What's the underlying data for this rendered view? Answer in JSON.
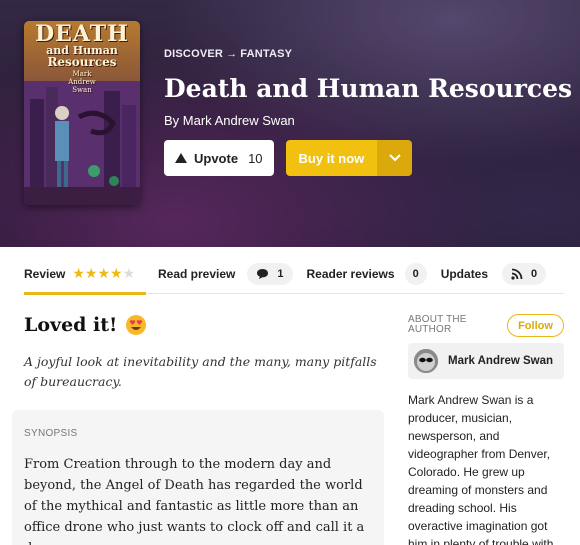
{
  "breadcrumb": {
    "parent": "DISCOVER",
    "separator": "→",
    "current": "FANTASY"
  },
  "book": {
    "title": "Death and Human Resources",
    "byline": "By Mark Andrew Swan",
    "cover": {
      "line1": "DEATH",
      "line2": "and Human",
      "line3": "Resources",
      "author_line1": "Mark",
      "author_line2": "Andrew",
      "author_line3": "Swan"
    }
  },
  "actions": {
    "upvote_label": "Upvote",
    "upvote_count": "10",
    "buy_label": "Buy it now"
  },
  "tabs": {
    "review": "Review",
    "rating": 4,
    "rating_max": 5,
    "read_preview": "Read preview",
    "comments_count": "1",
    "reader_reviews": "Reader reviews",
    "reader_reviews_count": "0",
    "updates": "Updates",
    "rss_count": "0"
  },
  "review": {
    "title": "Loved it!",
    "emoji": "😍",
    "tagline": "A joyful look at inevitability and the many, many pitfalls of bureaucracy."
  },
  "synopsis": {
    "label": "SYNOPSIS",
    "text": "From Creation through to the modern day and beyond, the Angel of Death has regarded the world of the mythical and fantastic as little more than an office drone who just wants to clock off and call it a day."
  },
  "author": {
    "about_label": "ABOUT THE AUTHOR",
    "follow_label": "Follow",
    "name": "Mark Andrew Swan",
    "bio": "Mark Andrew Swan is a producer, musician, newsperson, and videographer from Denver, Colorado. He grew up dreaming of monsters and dreading school. His overactive imagination got him in plenty of trouble with"
  },
  "colors": {
    "accent": "#f2c00f",
    "accent_dark": "#dba90b",
    "star": "#f0b90e"
  }
}
